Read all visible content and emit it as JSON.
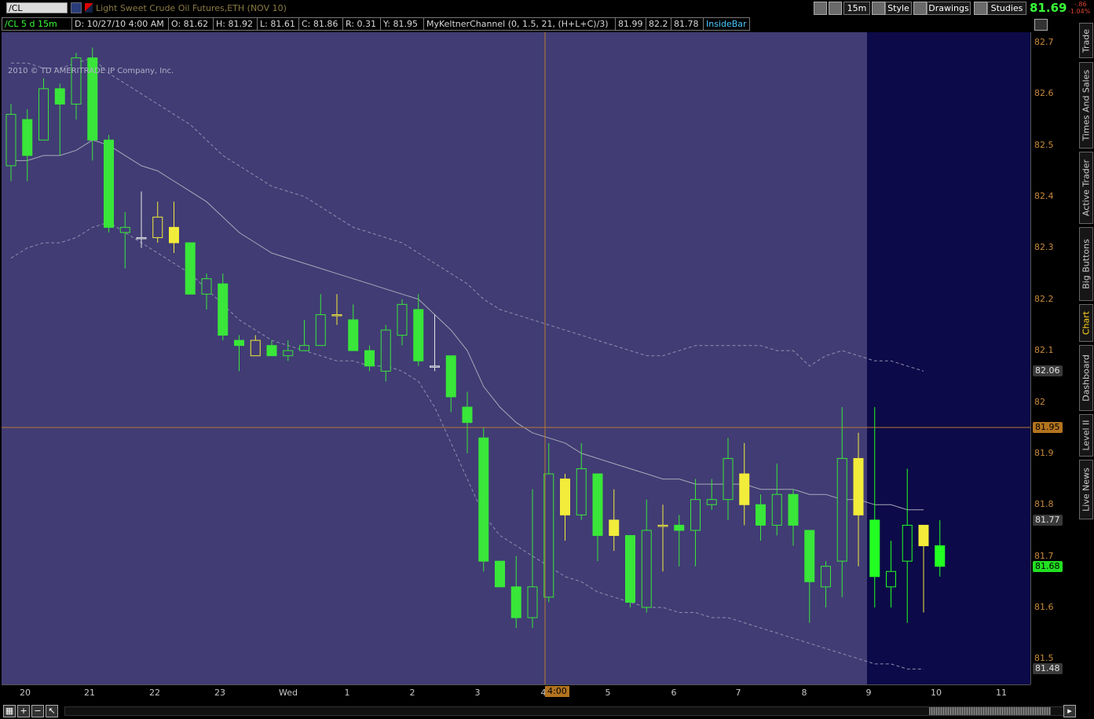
{
  "toolbar": {
    "symbol": "/CL",
    "instrument_title": "Light Sweet Crude Oil Futures,ETH (NOV 10)",
    "timeframe_label": "15m",
    "style_label": "Style",
    "drawings_label": "Drawings",
    "studies_label": "Studies",
    "last_price": "81.69",
    "change": "-.86",
    "change_pct": "-1.04%"
  },
  "infobar": {
    "symbol_period": "/CL 5 d 15m",
    "date": "D: 10/27/10 4:00 AM",
    "open": "O: 81.62",
    "high": "H: 81.92",
    "low": "L: 81.61",
    "close": "C: 81.86",
    "range": "R: 0.31",
    "y": "Y: 81.95",
    "study": "MyKeltnerChannel (0, 1.5, 21, (H+L+C)/3)",
    "study_upper": "81.99",
    "study_mid": "82.2",
    "study_lower": "81.78",
    "insidebar": "InsideBar"
  },
  "copyright": "2010 © TD AMERITRADE IP Company, Inc.",
  "y_ticks": [
    "82.7",
    "82.6",
    "82.5",
    "82.4",
    "82.3",
    "82.2",
    "82.1",
    "82",
    "81.9",
    "81.8",
    "81.7",
    "81.6",
    "81.5"
  ],
  "y_labels": {
    "upper": "82.06",
    "cursor": "81.95",
    "mid": "81.77",
    "last": "81.68",
    "lower": "81.48"
  },
  "x_ticks": [
    "20",
    "21",
    "22",
    "23",
    "Wed",
    "1",
    "2",
    "3",
    "4",
    "5",
    "6",
    "7",
    "8",
    "9",
    "10",
    "11"
  ],
  "x_cursor": "4:00",
  "right_tabs": [
    "Trade",
    "Times And Sales",
    "Active Trader",
    "Big Buttons",
    "Chart",
    "Dashboard",
    "Level II",
    "Live News"
  ],
  "colors": {
    "background": "#413c74",
    "future_zone": "#0c0a48",
    "bull": "#39e639",
    "neutral": "#f2ec3a",
    "crosshair": "#b87a33",
    "band": "#9a9ab0"
  },
  "chart_data": {
    "type": "candlestick",
    "y_range": [
      81.45,
      82.72
    ],
    "x_ticks": [
      "20",
      "21",
      "22",
      "23",
      "Wed",
      "1",
      "2",
      "3",
      "4",
      "5",
      "6",
      "7",
      "8",
      "9",
      "10",
      "11"
    ],
    "candles": [
      {
        "o": 82.46,
        "h": 82.58,
        "l": 82.43,
        "c": 82.56,
        "color": "green",
        "fill": "hollow"
      },
      {
        "o": 82.55,
        "h": 82.57,
        "l": 82.43,
        "c": 82.48,
        "color": "green",
        "fill": "solid"
      },
      {
        "o": 82.51,
        "h": 82.63,
        "l": 82.51,
        "c": 82.61,
        "color": "green",
        "fill": "hollow"
      },
      {
        "o": 82.61,
        "h": 82.62,
        "l": 82.48,
        "c": 82.58,
        "color": "green",
        "fill": "solid"
      },
      {
        "o": 82.58,
        "h": 82.68,
        "l": 82.55,
        "c": 82.67,
        "color": "green",
        "fill": "hollow"
      },
      {
        "o": 82.67,
        "h": 82.69,
        "l": 82.47,
        "c": 82.51,
        "color": "green",
        "fill": "solid"
      },
      {
        "o": 82.51,
        "h": 82.52,
        "l": 82.33,
        "c": 82.34,
        "color": "green",
        "fill": "solid"
      },
      {
        "o": 82.33,
        "h": 82.37,
        "l": 82.26,
        "c": 82.34,
        "color": "green",
        "fill": "hollow"
      },
      {
        "o": 82.32,
        "h": 82.41,
        "l": 82.3,
        "c": 82.32,
        "color": "neutral",
        "fill": "hollow"
      },
      {
        "o": 82.32,
        "h": 82.39,
        "l": 82.31,
        "c": 82.36,
        "color": "yellow",
        "fill": "hollow"
      },
      {
        "o": 82.34,
        "h": 82.39,
        "l": 82.29,
        "c": 82.31,
        "color": "yellow",
        "fill": "solid"
      },
      {
        "o": 82.31,
        "h": 82.31,
        "l": 82.21,
        "c": 82.21,
        "color": "green",
        "fill": "solid"
      },
      {
        "o": 82.21,
        "h": 82.25,
        "l": 82.18,
        "c": 82.24,
        "color": "green",
        "fill": "hollow"
      },
      {
        "o": 82.23,
        "h": 82.25,
        "l": 82.12,
        "c": 82.13,
        "color": "green",
        "fill": "solid"
      },
      {
        "o": 82.12,
        "h": 82.13,
        "l": 82.06,
        "c": 82.11,
        "color": "green",
        "fill": "solid"
      },
      {
        "o": 82.09,
        "h": 82.13,
        "l": 82.09,
        "c": 82.12,
        "color": "yellow",
        "fill": "hollow"
      },
      {
        "o": 82.11,
        "h": 82.12,
        "l": 82.09,
        "c": 82.09,
        "color": "green",
        "fill": "solid"
      },
      {
        "o": 82.09,
        "h": 82.12,
        "l": 82.08,
        "c": 82.1,
        "color": "green",
        "fill": "hollow"
      },
      {
        "o": 82.1,
        "h": 82.16,
        "l": 82.1,
        "c": 82.11,
        "color": "green",
        "fill": "hollow"
      },
      {
        "o": 82.11,
        "h": 82.21,
        "l": 82.11,
        "c": 82.17,
        "color": "green",
        "fill": "hollow"
      },
      {
        "o": 82.17,
        "h": 82.21,
        "l": 82.15,
        "c": 82.17,
        "color": "yellow",
        "fill": "hollow"
      },
      {
        "o": 82.16,
        "h": 82.19,
        "l": 82.1,
        "c": 82.1,
        "color": "green",
        "fill": "solid"
      },
      {
        "o": 82.1,
        "h": 82.11,
        "l": 82.06,
        "c": 82.07,
        "color": "green",
        "fill": "solid"
      },
      {
        "o": 82.06,
        "h": 82.15,
        "l": 82.04,
        "c": 82.14,
        "color": "green",
        "fill": "hollow"
      },
      {
        "o": 82.13,
        "h": 82.2,
        "l": 82.11,
        "c": 82.19,
        "color": "green",
        "fill": "hollow"
      },
      {
        "o": 82.18,
        "h": 82.21,
        "l": 82.07,
        "c": 82.08,
        "color": "green",
        "fill": "solid"
      },
      {
        "o": 82.07,
        "h": 82.17,
        "l": 82.06,
        "c": 82.07,
        "color": "neutral",
        "fill": "hollow"
      },
      {
        "o": 82.09,
        "h": 82.09,
        "l": 81.98,
        "c": 82.01,
        "color": "green",
        "fill": "solid"
      },
      {
        "o": 81.99,
        "h": 82.02,
        "l": 81.9,
        "c": 81.96,
        "color": "green",
        "fill": "solid"
      },
      {
        "o": 81.93,
        "h": 81.95,
        "l": 81.67,
        "c": 81.69,
        "color": "green",
        "fill": "solid"
      },
      {
        "o": 81.69,
        "h": 81.69,
        "l": 81.64,
        "c": 81.64,
        "color": "green",
        "fill": "solid"
      },
      {
        "o": 81.64,
        "h": 81.7,
        "l": 81.56,
        "c": 81.58,
        "color": "green",
        "fill": "solid"
      },
      {
        "o": 81.58,
        "h": 81.83,
        "l": 81.56,
        "c": 81.64,
        "color": "green",
        "fill": "hollow"
      },
      {
        "o": 81.62,
        "h": 81.92,
        "l": 81.61,
        "c": 81.86,
        "color": "green",
        "fill": "hollow"
      },
      {
        "o": 81.85,
        "h": 81.86,
        "l": 81.73,
        "c": 81.78,
        "color": "yellow",
        "fill": "solid"
      },
      {
        "o": 81.78,
        "h": 81.92,
        "l": 81.77,
        "c": 81.87,
        "color": "green",
        "fill": "hollow"
      },
      {
        "o": 81.86,
        "h": 81.86,
        "l": 81.69,
        "c": 81.74,
        "color": "green",
        "fill": "solid"
      },
      {
        "o": 81.77,
        "h": 81.83,
        "l": 81.71,
        "c": 81.74,
        "color": "yellow",
        "fill": "solid"
      },
      {
        "o": 81.74,
        "h": 81.74,
        "l": 81.6,
        "c": 81.61,
        "color": "green",
        "fill": "solid"
      },
      {
        "o": 81.6,
        "h": 81.81,
        "l": 81.59,
        "c": 81.75,
        "color": "green",
        "fill": "hollow"
      },
      {
        "o": 81.76,
        "h": 81.8,
        "l": 81.67,
        "c": 81.76,
        "color": "yellow",
        "fill": "hollow"
      },
      {
        "o": 81.76,
        "h": 81.78,
        "l": 81.68,
        "c": 81.75,
        "color": "green",
        "fill": "solid"
      },
      {
        "o": 81.75,
        "h": 81.85,
        "l": 81.68,
        "c": 81.81,
        "color": "green",
        "fill": "hollow"
      },
      {
        "o": 81.8,
        "h": 81.85,
        "l": 81.79,
        "c": 81.81,
        "color": "green",
        "fill": "hollow"
      },
      {
        "o": 81.81,
        "h": 81.93,
        "l": 81.77,
        "c": 81.89,
        "color": "green",
        "fill": "hollow"
      },
      {
        "o": 81.86,
        "h": 81.92,
        "l": 81.76,
        "c": 81.8,
        "color": "yellow",
        "fill": "solid"
      },
      {
        "o": 81.8,
        "h": 81.82,
        "l": 81.73,
        "c": 81.76,
        "color": "green",
        "fill": "solid"
      },
      {
        "o": 81.76,
        "h": 81.88,
        "l": 81.74,
        "c": 81.82,
        "color": "green",
        "fill": "hollow"
      },
      {
        "o": 81.82,
        "h": 81.83,
        "l": 81.72,
        "c": 81.76,
        "color": "green",
        "fill": "solid"
      },
      {
        "o": 81.75,
        "h": 81.75,
        "l": 81.57,
        "c": 81.65,
        "color": "green",
        "fill": "solid"
      },
      {
        "o": 81.64,
        "h": 81.69,
        "l": 81.6,
        "c": 81.68,
        "color": "green",
        "fill": "hollow"
      },
      {
        "o": 81.69,
        "h": 81.99,
        "l": 81.62,
        "c": 81.89,
        "color": "green",
        "fill": "hollow"
      },
      {
        "o": 81.89,
        "h": 81.94,
        "l": 81.68,
        "c": 81.78,
        "color": "yellow",
        "fill": "solid"
      },
      {
        "o": 81.77,
        "h": 81.99,
        "l": 81.6,
        "c": 81.66,
        "color": "bright-green",
        "fill": "solid"
      },
      {
        "o": 81.64,
        "h": 81.73,
        "l": 81.6,
        "c": 81.67,
        "color": "bright-green",
        "fill": "hollow"
      },
      {
        "o": 81.69,
        "h": 81.87,
        "l": 81.57,
        "c": 81.76,
        "color": "bright-green",
        "fill": "hollow"
      },
      {
        "o": 81.76,
        "h": 81.76,
        "l": 81.59,
        "c": 81.72,
        "color": "yellow",
        "fill": "solid"
      },
      {
        "o": 81.72,
        "h": 81.77,
        "l": 81.66,
        "c": 81.68,
        "color": "bright-green",
        "fill": "solid"
      }
    ],
    "keltner_upper": [
      82.66,
      82.66,
      82.65,
      82.65,
      82.66,
      82.67,
      82.64,
      82.62,
      82.6,
      82.58,
      82.56,
      82.54,
      82.51,
      82.48,
      82.46,
      82.44,
      82.42,
      82.41,
      82.4,
      82.38,
      82.36,
      82.34,
      82.33,
      82.32,
      82.31,
      82.29,
      82.27,
      82.25,
      82.23,
      82.2,
      82.18,
      82.17,
      82.16,
      82.15,
      82.14,
      82.13,
      82.12,
      82.11,
      82.1,
      82.09,
      82.09,
      82.1,
      82.11,
      82.11,
      82.11,
      82.11,
      82.11,
      82.1,
      82.1,
      82.07,
      82.09,
      82.1,
      82.09,
      82.08,
      82.08,
      82.07,
      82.06
    ],
    "keltner_mid": [
      82.47,
      82.47,
      82.48,
      82.48,
      82.49,
      82.51,
      82.5,
      82.48,
      82.46,
      82.45,
      82.43,
      82.41,
      82.39,
      82.36,
      82.33,
      82.31,
      82.29,
      82.28,
      82.27,
      82.26,
      82.25,
      82.24,
      82.23,
      82.22,
      82.21,
      82.2,
      82.17,
      82.14,
      82.1,
      82.03,
      81.99,
      81.96,
      81.94,
      81.93,
      81.92,
      81.9,
      81.89,
      81.88,
      81.87,
      81.86,
      81.85,
      81.85,
      81.84,
      81.84,
      81.84,
      81.84,
      81.83,
      81.83,
      81.83,
      81.82,
      81.82,
      81.81,
      81.81,
      81.8,
      81.8,
      81.79,
      81.79
    ],
    "keltner_lower": [
      82.28,
      82.3,
      82.31,
      82.31,
      82.32,
      82.34,
      82.35,
      82.33,
      82.31,
      82.29,
      82.27,
      82.25,
      82.22,
      82.19,
      82.16,
      82.14,
      82.12,
      82.11,
      82.1,
      82.09,
      82.08,
      82.08,
      82.07,
      82.07,
      82.06,
      82.04,
      81.99,
      81.92,
      81.85,
      81.78,
      81.74,
      81.72,
      81.7,
      81.68,
      81.66,
      81.65,
      81.63,
      81.62,
      81.61,
      81.6,
      81.6,
      81.59,
      81.59,
      81.58,
      81.58,
      81.57,
      81.56,
      81.55,
      81.54,
      81.53,
      81.52,
      81.51,
      81.5,
      81.49,
      81.49,
      81.48,
      81.48
    ]
  }
}
